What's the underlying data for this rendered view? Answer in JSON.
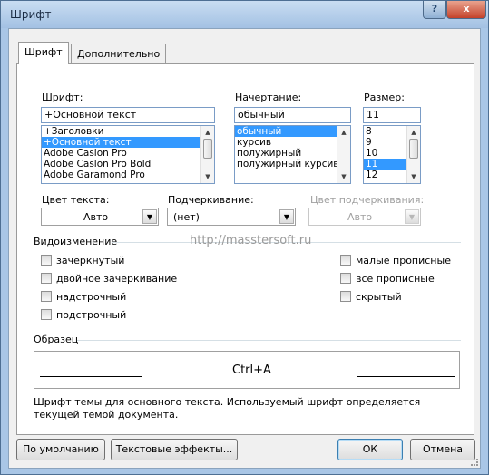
{
  "window": {
    "title": "Шрифт",
    "help_label": "?",
    "close_label": "x"
  },
  "tabs": [
    "Шрифт",
    "Дополнительно"
  ],
  "font": {
    "label": "Шрифт:",
    "value": "+Основной текст",
    "items": [
      "+Заголовки",
      "+Основной текст",
      "Adobe Caslon Pro",
      "Adobe Caslon Pro Bold",
      "Adobe Garamond Pro"
    ],
    "selected": "+Основной текст"
  },
  "style": {
    "label": "Начертание:",
    "value": "обычный",
    "items": [
      "обычный",
      "курсив",
      "полужирный",
      "полужирный курсив"
    ],
    "selected": "обычный"
  },
  "size": {
    "label": "Размер:",
    "value": "11",
    "items": [
      "8",
      "9",
      "10",
      "11",
      "12"
    ],
    "selected": "11"
  },
  "text_color": {
    "label": "Цвет текста:",
    "value": "Авто"
  },
  "underline": {
    "label": "Подчеркивание:",
    "value": "(нет)"
  },
  "underline_color": {
    "label": "Цвет подчеркивания:",
    "value": "Авто"
  },
  "effects": {
    "label": "Видоизменение",
    "left": [
      "зачеркнутый",
      "двойное зачеркивание",
      "надстрочный",
      "подстрочный"
    ],
    "right": [
      "малые прописные",
      "все прописные",
      "скрытый"
    ]
  },
  "watermark": "http://masstersoft.ru",
  "preview": {
    "label": "Образец",
    "sample": "Ctrl+A",
    "description": "Шрифт темы для основного текста. Используемый шрифт определяется текущей темой документа."
  },
  "buttons": {
    "default": "По умолчанию",
    "text_effects": "Текстовые эффекты...",
    "ok": "ОК",
    "cancel": "Отмена"
  },
  "colors": {
    "title_bar": "#a9c6e6",
    "selection": "#3399ff",
    "close_button": "#c4422b"
  }
}
